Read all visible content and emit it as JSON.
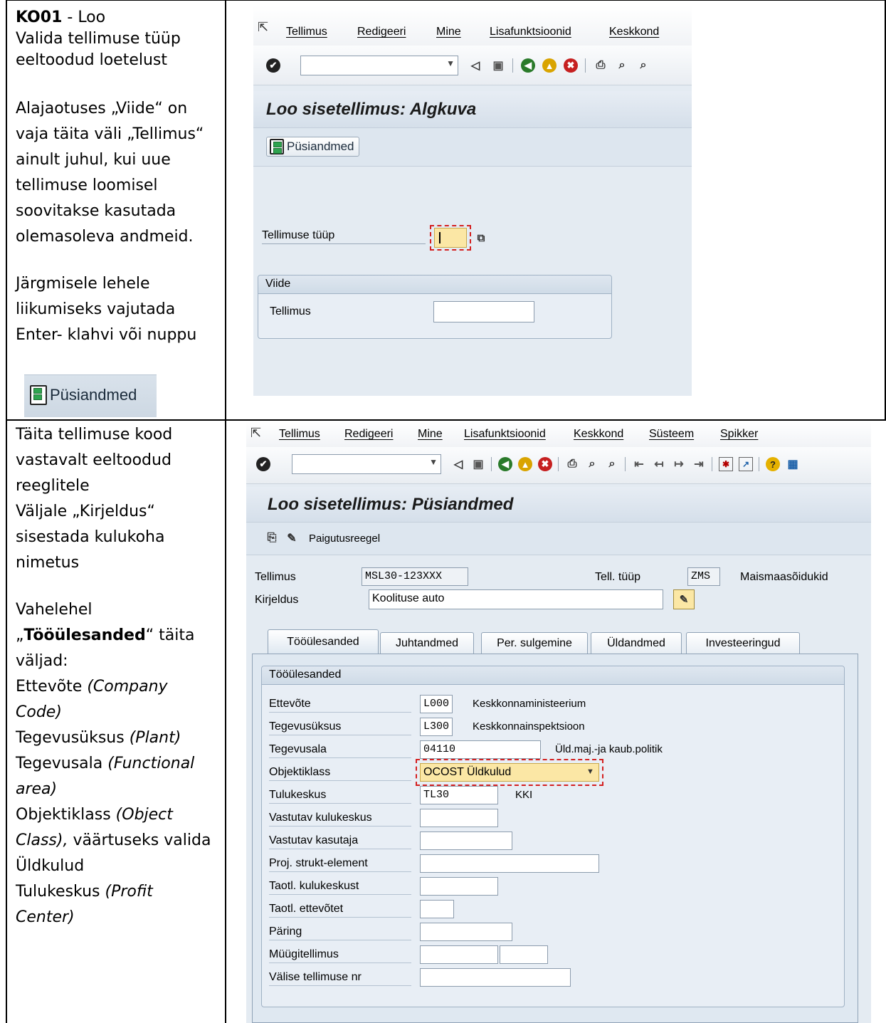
{
  "row1_instructions": {
    "code": "KO01",
    "code_suffix": " - Loo",
    "lines": [
      "Valida tellimuse tüüp",
      "eeltoodud loetelust"
    ],
    "para2": [
      "Alajaotuses „Viide“ on",
      "vaja täita väli „Tellimus“",
      "ainult juhul, kui uue",
      "tellimuse loomisel",
      "soovitakse kasutada",
      "olemasoleva andmeid."
    ],
    "para3": [
      "Järgmisele lehele",
      "liikumiseks vajutada",
      "Enter- klahvi või nuppu"
    ],
    "button_label": "Püsiandmed"
  },
  "row2_instructions": {
    "para1": [
      "Täita tellimuse kood",
      "vastavalt eeltoodud",
      "reeglitele",
      "Väljale „Kirjeldus“",
      "sisestada kulukoha",
      "nimetus"
    ],
    "tab_intro_prefix": "Vahelehel",
    "tab_quote_open": "„",
    "tab_name": "Tööülesanded",
    "tab_quote_close_suffix": "“ täita",
    "fields_intro": "väljad:",
    "fields": [
      {
        "name": "Ettevõte ",
        "hint": "(Company"
      },
      {
        "name": "",
        "hint": "Code)"
      },
      {
        "name": "Tegevusüksus ",
        "hint": "(Plant)"
      },
      {
        "name": "Tegevusala ",
        "hint": "(Functional"
      },
      {
        "name": "",
        "hint": "area)"
      },
      {
        "name": "Objektiklass ",
        "hint": "(Object"
      },
      {
        "name": "",
        "hint": "Class),",
        "tail": " väärtuseks valida"
      },
      {
        "name": "Üldkulud",
        "hint": ""
      },
      {
        "name": "Tulukeskus ",
        "hint": "(Profit"
      },
      {
        "name": "",
        "hint": "Center)"
      }
    ]
  },
  "sap1": {
    "menu": [
      "Tellimus",
      "Redigeeri",
      "Mine",
      "Lisafunktsioonid",
      "Keskkond"
    ],
    "title": "Loo sisetellimus: Algkuva",
    "app_button": "Püsiandmed",
    "field_order_type_label": "Tellimuse tüüp",
    "order_type_value": "",
    "group_title": "Viide",
    "ref_order_label": "Tellimus",
    "ref_order_value": ""
  },
  "sap2": {
    "menu": [
      "Tellimus",
      "Redigeeri",
      "Mine",
      "Lisafunktsioonid",
      "Keskkond",
      "Süsteem",
      "Spikker"
    ],
    "title": "Loo sisetellimus: Püsiandmed",
    "app_button": "Paigutusreegel",
    "header": {
      "order_label": "Tellimus",
      "order_value": "MSL30-123XXX",
      "order_type_label": "Tell. tüüp",
      "order_type_value": "ZMS",
      "order_type_text": "Maismaasõidukid",
      "desc_label": "Kirjeldus",
      "desc_value": "Koolituse auto"
    },
    "tabs": [
      "Tööülesanded",
      "Juhtandmed",
      "Per. sulgemine",
      "Üldandmed",
      "Investeeringud"
    ],
    "group_title": "Tööülesanded",
    "fields": [
      {
        "label": "Ettevõte",
        "value": "L000",
        "text": "Keskkonnaministeerium"
      },
      {
        "label": "Tegevusüksus",
        "value": "L300",
        "text": "Keskkonnainspektsioon"
      },
      {
        "label": "Tegevusala",
        "value": "04110",
        "text": "Üld.maj.-ja kaub.politik"
      },
      {
        "label": "Objektiklass",
        "value": "OCOST Üldkulud",
        "text": ""
      },
      {
        "label": "Tulukeskus",
        "value": "TL30",
        "text": "KKI"
      },
      {
        "label": "Vastutav kulukeskus",
        "value": "",
        "text": ""
      },
      {
        "label": "Vastutav kasutaja",
        "value": "",
        "text": ""
      },
      {
        "label": "Proj. strukt-element",
        "value": "",
        "text": ""
      },
      {
        "label": "Taotl. kulukeskust",
        "value": "",
        "text": ""
      },
      {
        "label": "Taotl. ettevõtet",
        "value": "",
        "text": ""
      },
      {
        "label": "Päring",
        "value": "",
        "text": ""
      },
      {
        "label": "Müügitellimus",
        "value": "",
        "text": ""
      },
      {
        "label": "Välise tellimuse nr",
        "value": "",
        "text": ""
      }
    ]
  }
}
